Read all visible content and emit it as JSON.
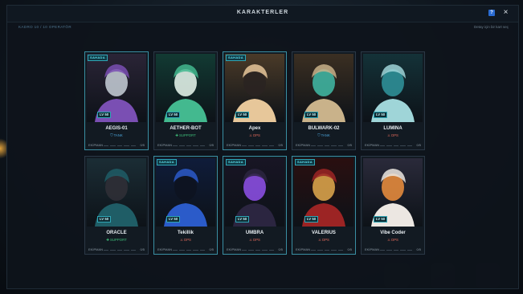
{
  "header": {
    "title": "KARAKTERLER",
    "help_label": "?",
    "close_label": "×",
    "roster_count": "KADRO 10 / 10 OPERATÖR",
    "hint": "Detay için bir kart seç"
  },
  "deployed_tag": "SAHADA",
  "equipment_label": "EKİPMAN",
  "characters": [
    {
      "name": "AEGIS-01",
      "level": "LV 50",
      "role": "⛉ TANK",
      "role_type": "tank",
      "deployed": true,
      "equipment": "0/5",
      "palette": [
        "#2a2436",
        "#7a4fb3",
        "#bfc6cf"
      ]
    },
    {
      "name": "AETHER-BOT",
      "level": "LV 50",
      "role": "✚ SUPPORT",
      "role_type": "support",
      "deployed": false,
      "equipment": "0/5",
      "palette": [
        "#123a33",
        "#43b98f",
        "#dfeee6"
      ]
    },
    {
      "name": "Apex",
      "level": "LV 50",
      "role": "⚔ DPS",
      "role_type": "dps",
      "deployed": true,
      "equipment": "0/5",
      "palette": [
        "#4a3a28",
        "#e7c79a",
        "#2a2421"
      ]
    },
    {
      "name": "BULWARK-02",
      "level": "LV 50",
      "role": "⛉ TANK",
      "role_type": "tank",
      "deployed": false,
      "equipment": "0/5",
      "palette": [
        "#3b2f22",
        "#c9b28a",
        "#3fb2a0"
      ]
    },
    {
      "name": "LUMINA",
      "level": "LV 50",
      "role": "⚔ DPS",
      "role_type": "dps",
      "deployed": false,
      "equipment": "0/5",
      "palette": [
        "#143238",
        "#9fd5d8",
        "#2f8f97"
      ]
    },
    {
      "name": "ORACLE",
      "level": "LV 50",
      "role": "✚ SUPPORT",
      "role_type": "support",
      "deployed": false,
      "equipment": "0/5",
      "palette": [
        "#1b2d35",
        "#1f5d66",
        "#2f2f36"
      ]
    },
    {
      "name": "Tekillik",
      "level": "LV 50",
      "role": "⚔ DPS",
      "role_type": "dps",
      "deployed": true,
      "equipment": "0/5",
      "palette": [
        "#0f1c3a",
        "#2b5bc9",
        "#0d1320"
      ]
    },
    {
      "name": "UMBRA",
      "level": "LV 50",
      "role": "⚔ DPS",
      "role_type": "dps",
      "deployed": true,
      "equipment": "0/5",
      "palette": [
        "#181524",
        "#2b2540",
        "#8a4ee0"
      ]
    },
    {
      "name": "VALERIUS",
      "level": "LV 50",
      "role": "⚔ DPS",
      "role_type": "dps",
      "deployed": true,
      "equipment": "0/5",
      "palette": [
        "#2a0f10",
        "#9c2424",
        "#d8a24a"
      ]
    },
    {
      "name": "Vibe Coder",
      "level": "LV 50",
      "role": "⚔ DPS",
      "role_type": "dps",
      "deployed": false,
      "equipment": "0/5",
      "palette": [
        "#2a2a3a",
        "#ece7e2",
        "#e38a3c"
      ]
    }
  ]
}
